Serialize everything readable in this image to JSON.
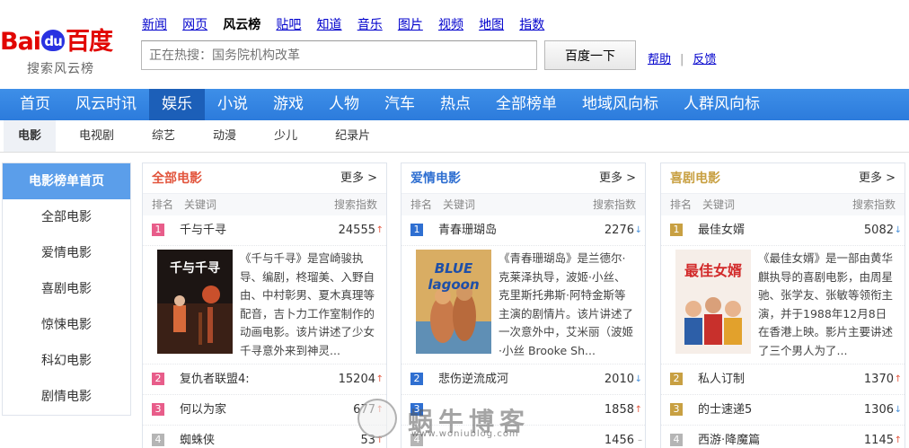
{
  "header": {
    "logo_text_left": "Bai",
    "logo_text_mid": "du",
    "logo_text_right": "百度",
    "logo_subtitle": "搜索风云榜",
    "top_links": [
      "新闻",
      "网页",
      "风云榜",
      "贴吧",
      "知道",
      "音乐",
      "图片",
      "视频",
      "地图",
      "指数"
    ],
    "current_top_link": "风云榜",
    "search_placeholder": "正在热搜：国务院机构改革",
    "search_button": "百度一下",
    "help_label": "帮助",
    "feedback_label": "反馈",
    "separator": "|"
  },
  "main_nav": {
    "items": [
      "首页",
      "风云时讯",
      "娱乐",
      "小说",
      "游戏",
      "人物",
      "汽车",
      "热点",
      "全部榜单",
      "地域风向标",
      "人群风向标"
    ],
    "active": "娱乐"
  },
  "sub_nav": {
    "items": [
      "电影",
      "电视剧",
      "综艺",
      "动漫",
      "少儿",
      "纪录片"
    ],
    "active": "电影"
  },
  "sidebar": {
    "head": "电影榜单首页",
    "items": [
      "全部电影",
      "爱情电影",
      "喜剧电影",
      "惊悚电影",
      "科幻电影",
      "剧情电影"
    ]
  },
  "columns": {
    "rank": "排名",
    "keyword": "关键词",
    "index": "搜索指数"
  },
  "panels": [
    {
      "title": "全部电影",
      "title_color": "#e2553d",
      "more": "更多 >",
      "top": {
        "rank": "1",
        "name": "千与千寻",
        "index": "24555",
        "trend": "up",
        "poster_title": "千与千寻",
        "desc": "《千与千寻》是宫崎骏执导、编剧，柊瑠美、入野自由、中村彰男、夏木真理等配音，吉卜力工作室制作的动画电影。该片讲述了少女千寻意外来到神灵..."
      },
      "rows": [
        {
          "rank": "2",
          "name": "复仇者联盟4:",
          "index": "15204",
          "trend": "up"
        },
        {
          "rank": "3",
          "name": "何以为家",
          "index": "677",
          "trend": "up"
        },
        {
          "rank": "4",
          "name": "蜘蛛侠",
          "index": "53",
          "trend": "up"
        }
      ]
    },
    {
      "title": "爱情电影",
      "title_color": "#2f6fd1",
      "more": "更多 >",
      "top": {
        "rank": "1",
        "name": "青春珊瑚岛",
        "index": "2276",
        "trend": "down",
        "poster_title": "BLUE lagoon",
        "desc": "《青春珊瑚岛》是兰德尔·克莱泽执导，波姬·小丝、克里斯托弗斯·阿特金斯等主演的剧情片。该片讲述了一次意外中，艾米丽（波姬·小丝 Brooke Sh..."
      },
      "rows": [
        {
          "rank": "2",
          "name": "悲伤逆流成河",
          "index": "2010",
          "trend": "down"
        },
        {
          "rank": "3",
          "name": "",
          "index": "1858",
          "trend": "up"
        },
        {
          "rank": "4",
          "name": "",
          "index": "1456",
          "trend": "flat"
        }
      ]
    },
    {
      "title": "喜剧电影",
      "title_color": "#c8a042",
      "more": "更多 >",
      "top": {
        "rank": "1",
        "name": "最佳女婿",
        "index": "5082",
        "trend": "down",
        "poster_title": "最佳女婿",
        "desc": "《最佳女婿》是一部由黄华麒执导的喜剧电影，由周星驰、张学友、张敏等领衔主演，并于1988年12月8日在香港上映。影片主要讲述了三个男人为了..."
      },
      "rows": [
        {
          "rank": "2",
          "name": "私人订制",
          "index": "1370",
          "trend": "up"
        },
        {
          "rank": "3",
          "name": "的士速递5",
          "index": "1306",
          "trend": "down"
        },
        {
          "rank": "4",
          "name": "西游·降魔篇",
          "index": "1145",
          "trend": "up"
        }
      ]
    }
  ],
  "watermark": {
    "text": "蜗牛博客",
    "url": "www.woniublog.com"
  },
  "arrows": {
    "up": "↑",
    "down": "↓",
    "flat": "–"
  },
  "colors": {
    "nav_blue": "#3e8fe8",
    "nav_active": "#1c5fb8",
    "sidebar_head": "#5b9eea"
  }
}
